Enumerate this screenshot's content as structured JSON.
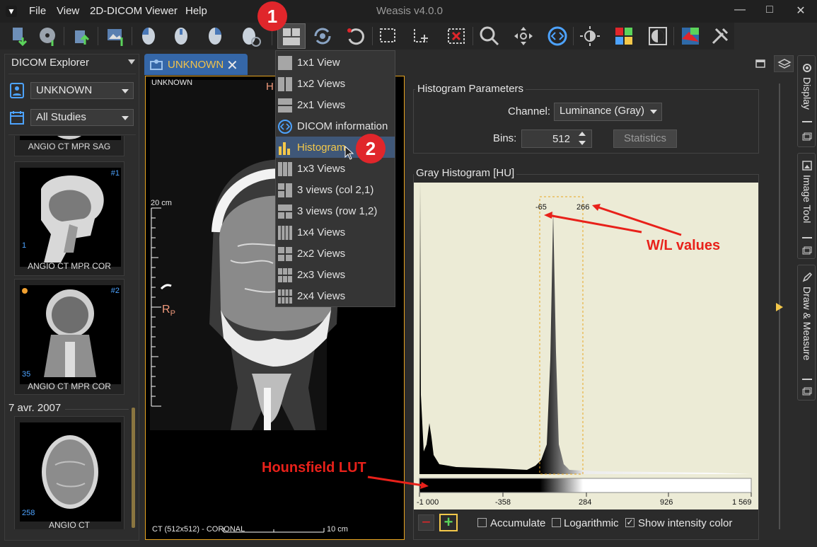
{
  "window": {
    "title": "Weasis v4.0.0",
    "menus": [
      "File",
      "View",
      "2D-DICOM Viewer",
      "Help"
    ],
    "controls": [
      "minimize",
      "maximize",
      "close"
    ]
  },
  "badges": {
    "step1": "1",
    "step2": "2"
  },
  "explorer": {
    "title": "DICOM Explorer",
    "patient": "UNKNOWN",
    "studies": "All Studies",
    "date_header": "7 avr. 2007",
    "series": [
      {
        "label": "ANGIO CT MPR SAG",
        "number": "",
        "count": ""
      },
      {
        "label": "ANGIO CT MPR COR",
        "number": "#1",
        "count": "1"
      },
      {
        "label": "ANGIO CT MPR COR",
        "number": "#2",
        "count": "35"
      },
      {
        "label": "ANGIO CT",
        "number": "",
        "count": "258"
      }
    ]
  },
  "viewer": {
    "tab_label": "UNKNOWN",
    "top_left": "UNKNOWN",
    "top_right_partial": "H",
    "scale_label": "20 cm",
    "orientation": "R",
    "orientation_sub": "P",
    "bottom_left": "CT (512x512) - CORONAL",
    "bottom_scale": "10 cm"
  },
  "popup_menu": {
    "items": [
      {
        "label": "1x1 View",
        "icon": "layout-1x1-icon"
      },
      {
        "label": "1x2 Views",
        "icon": "layout-1x2-icon"
      },
      {
        "label": "2x1 Views",
        "icon": "layout-2x1-icon"
      },
      {
        "label": "DICOM information",
        "icon": "dicom-info-icon"
      },
      {
        "label": "Histogram",
        "icon": "histogram-icon",
        "selected": true
      },
      {
        "label": "1x3 Views",
        "icon": "layout-1x3-icon"
      },
      {
        "label": "3 views (col 2,1)",
        "icon": "layout-3col-icon"
      },
      {
        "label": "3 views (row 1,2)",
        "icon": "layout-3row-icon"
      },
      {
        "label": "1x4 Views",
        "icon": "layout-1x4-icon"
      },
      {
        "label": "2x2 Views",
        "icon": "layout-2x2-icon"
      },
      {
        "label": "2x3 Views",
        "icon": "layout-2x3-icon"
      },
      {
        "label": "2x4 Views",
        "icon": "layout-2x4-icon"
      }
    ]
  },
  "histogram": {
    "params_title": "Histogram Parameters",
    "channel_label": "Channel:",
    "channel_value": "Luminance (Gray)",
    "bins_label": "Bins:",
    "bins_value": "512",
    "statistics_button": "Statistics",
    "panel_title": "Gray Histogram [HU]",
    "window_low": "-65",
    "window_high": "266",
    "axis_ticks": [
      "-1 000",
      "-358",
      "284",
      "926",
      "1 569"
    ],
    "annotation_wl": "W/L values",
    "annotation_lut": "Hounsfield LUT",
    "checkboxes": [
      {
        "label": "Accumulate",
        "checked": false
      },
      {
        "label": "Logarithmic",
        "checked": false
      },
      {
        "label": "Show intensity color",
        "checked": true
      }
    ]
  },
  "right_panels": [
    "Display",
    "Image Tool",
    "Draw & Measure"
  ],
  "colors": {
    "accent": "#e7a41f",
    "tab_blue": "#3567a8",
    "badge_red": "#e0262b",
    "annotation_red": "#e8211a"
  }
}
